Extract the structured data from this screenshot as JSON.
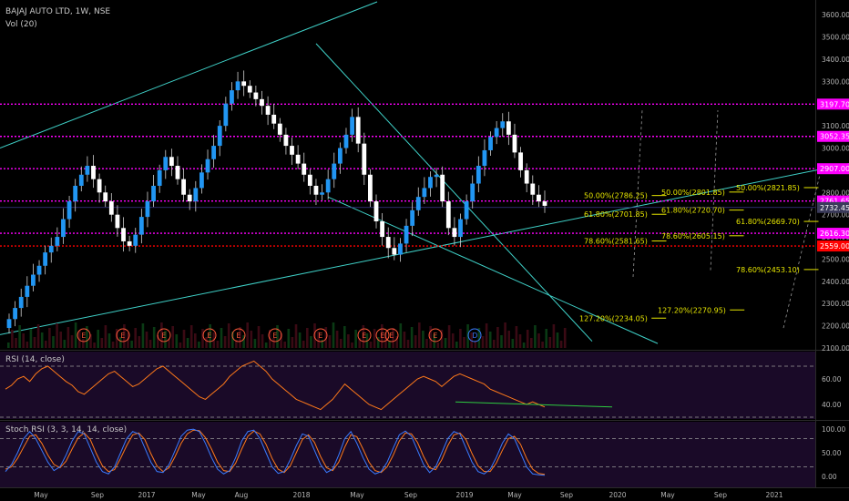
{
  "header": {
    "symbol": "BAJAJ AUTO LTD, 1W, NSE",
    "vol": "Vol (20)",
    "rsi": "RSI (14, close)",
    "stoch": "Stoch RSI (3, 3, 14, 14, close)"
  },
  "colors": {
    "up": "#2196f3",
    "down": "#ffffff",
    "wick": "#d0d0d0",
    "magenta": "#ff00ff",
    "red": "#ff0000",
    "cyan": "#3fd1c8",
    "fib": "#e6e600",
    "rsi": "#ff7a1a",
    "stochK": "#3a7bff",
    "stochD": "#ff7a1a",
    "divergence": "#2ecc40"
  },
  "chart_data": [
    {
      "type": "candlestick",
      "title": "BAJAJ AUTO LTD, 1W, NSE",
      "ylim": [
        2100,
        3650
      ],
      "y_ticks": [
        "3600.00",
        "3500.00",
        "3400.00",
        "3300.00",
        "3200.00",
        "3100.00",
        "3000.00",
        "2900.00",
        "2800.00",
        "2700.00",
        "2600.00",
        "2500.00",
        "2400.00",
        "2300.00",
        "2200.00",
        "2100.00"
      ],
      "x_ticks": [
        "May",
        "Sep",
        "2017",
        "May",
        "Aug",
        "2018",
        "May",
        "Sep",
        "2019",
        "May",
        "Sep",
        "2020",
        "May",
        "Sep",
        "2021"
      ],
      "candles_close": [
        2230,
        2280,
        2330,
        2380,
        2430,
        2470,
        2530,
        2560,
        2600,
        2680,
        2760,
        2830,
        2880,
        2920,
        2860,
        2800,
        2760,
        2700,
        2640,
        2580,
        2560,
        2610,
        2690,
        2760,
        2830,
        2900,
        2960,
        2920,
        2860,
        2790,
        2760,
        2820,
        2890,
        2950,
        3010,
        3100,
        3200,
        3260,
        3300,
        3280,
        3250,
        3220,
        3190,
        3150,
        3110,
        3060,
        3010,
        2970,
        2930,
        2880,
        2830,
        2790,
        2800,
        2860,
        2930,
        3000,
        3060,
        3140,
        3020,
        2880,
        2760,
        2670,
        2600,
        2550,
        2520,
        2570,
        2650,
        2720,
        2780,
        2820,
        2870,
        2880,
        2760,
        2640,
        2600,
        2680,
        2760,
        2840,
        2920,
        2990,
        3050,
        3090,
        3120,
        3060,
        2980,
        2900,
        2840,
        2790,
        2760,
        2740
      ],
      "price_labels": [
        {
          "value": 3197.7,
          "text": "3197.70",
          "color": "#ff00ff"
        },
        {
          "value": 3052.35,
          "text": "3052.35",
          "color": "#ff00ff"
        },
        {
          "value": 2907.0,
          "text": "2907.00",
          "color": "#ff00ff"
        },
        {
          "value": 2761.65,
          "text": "2761.65",
          "color": "#ff00ff"
        },
        {
          "value": 2732.45,
          "text": "2732.45",
          "color": "#3a3a5a"
        },
        {
          "value": 2616.3,
          "text": "2616.30",
          "color": "#ff00ff"
        },
        {
          "value": 2559.0,
          "text": "2559.00",
          "color": "#ff0000"
        }
      ],
      "fib_labels": [
        {
          "text": "50.00%(2786.25)",
          "value": 2786.25
        },
        {
          "text": "61.80%(2701.85)",
          "value": 2701.85
        },
        {
          "text": "78.60%(2581.65)",
          "value": 2581.65
        },
        {
          "text": "127.20%(2234.05)",
          "value": 2234.05
        },
        {
          "text": "50.00%(2801.85)",
          "value": 2801.85
        },
        {
          "text": "61.80%(2720.70)",
          "value": 2720.7
        },
        {
          "text": "78.60%(2605.15)",
          "value": 2605.15
        },
        {
          "text": "127.20%(2270.95)",
          "value": 2270.95
        },
        {
          "text": "50.00%(2821.85)",
          "value": 2821.85
        },
        {
          "text": "61.80%(2669.70)",
          "value": 2669.7
        },
        {
          "text": "78.60%(2453.10)",
          "value": 2453.1
        }
      ],
      "events": [
        "E",
        "E",
        "E",
        "E",
        "E",
        "E",
        "E",
        "E",
        "E",
        "E",
        "E",
        "D"
      ]
    },
    {
      "type": "line",
      "title": "RSI (14, close)",
      "ylim": [
        30,
        80
      ],
      "y_ticks": [
        "60.00",
        "40.00"
      ],
      "values": [
        52,
        55,
        60,
        62,
        58,
        64,
        68,
        70,
        66,
        62,
        58,
        55,
        50,
        48,
        52,
        56,
        60,
        64,
        66,
        62,
        58,
        54,
        56,
        60,
        64,
        68,
        70,
        66,
        62,
        58,
        54,
        50,
        46,
        44,
        48,
        52,
        56,
        62,
        66,
        70,
        72,
        74,
        70,
        66,
        60,
        56,
        52,
        48,
        44,
        42,
        40,
        38,
        36,
        40,
        44,
        50,
        56,
        52,
        48,
        44,
        40,
        38,
        36,
        40,
        44,
        48,
        52,
        56,
        60,
        62,
        60,
        58,
        54,
        58,
        62,
        64,
        62,
        60,
        58,
        56,
        52,
        50,
        48,
        46,
        44,
        42,
        40,
        42,
        40,
        38
      ],
      "divergence_label": "RSI divergence"
    },
    {
      "type": "line",
      "title": "Stoch RSI (3, 3, 14, 14, close)",
      "ylim": [
        -10,
        110
      ],
      "y_ticks": [
        "100.00",
        "50.00",
        "0.00"
      ],
      "k": [
        10,
        25,
        50,
        80,
        95,
        80,
        55,
        30,
        12,
        20,
        45,
        75,
        95,
        90,
        60,
        30,
        10,
        5,
        20,
        50,
        80,
        95,
        90,
        60,
        30,
        10,
        8,
        25,
        55,
        85,
        98,
        100,
        95,
        70,
        40,
        15,
        5,
        12,
        40,
        75,
        95,
        98,
        80,
        50,
        20,
        6,
        10,
        35,
        65,
        90,
        85,
        55,
        25,
        8,
        15,
        45,
        80,
        95,
        70,
        40,
        15,
        5,
        10,
        30,
        60,
        88,
        96,
        85,
        55,
        25,
        8,
        20,
        50,
        80,
        95,
        90,
        60,
        30,
        10,
        5,
        15,
        40,
        70,
        90,
        80,
        50,
        20,
        5,
        3,
        2
      ],
      "d": [
        15,
        20,
        38,
        62,
        85,
        88,
        70,
        45,
        25,
        18,
        32,
        58,
        82,
        92,
        78,
        48,
        22,
        10,
        14,
        38,
        65,
        88,
        92,
        78,
        48,
        22,
        10,
        18,
        42,
        70,
        90,
        98,
        97,
        82,
        58,
        30,
        12,
        10,
        28,
        58,
        85,
        96,
        90,
        68,
        38,
        15,
        8,
        22,
        50,
        78,
        88,
        72,
        42,
        18,
        12,
        30,
        62,
        88,
        84,
        58,
        30,
        12,
        8,
        20,
        45,
        75,
        92,
        90,
        72,
        42,
        18,
        14,
        35,
        65,
        88,
        92,
        78,
        48,
        22,
        10,
        10,
        28,
        55,
        80,
        85,
        68,
        38,
        15,
        6,
        4
      ]
    }
  ]
}
